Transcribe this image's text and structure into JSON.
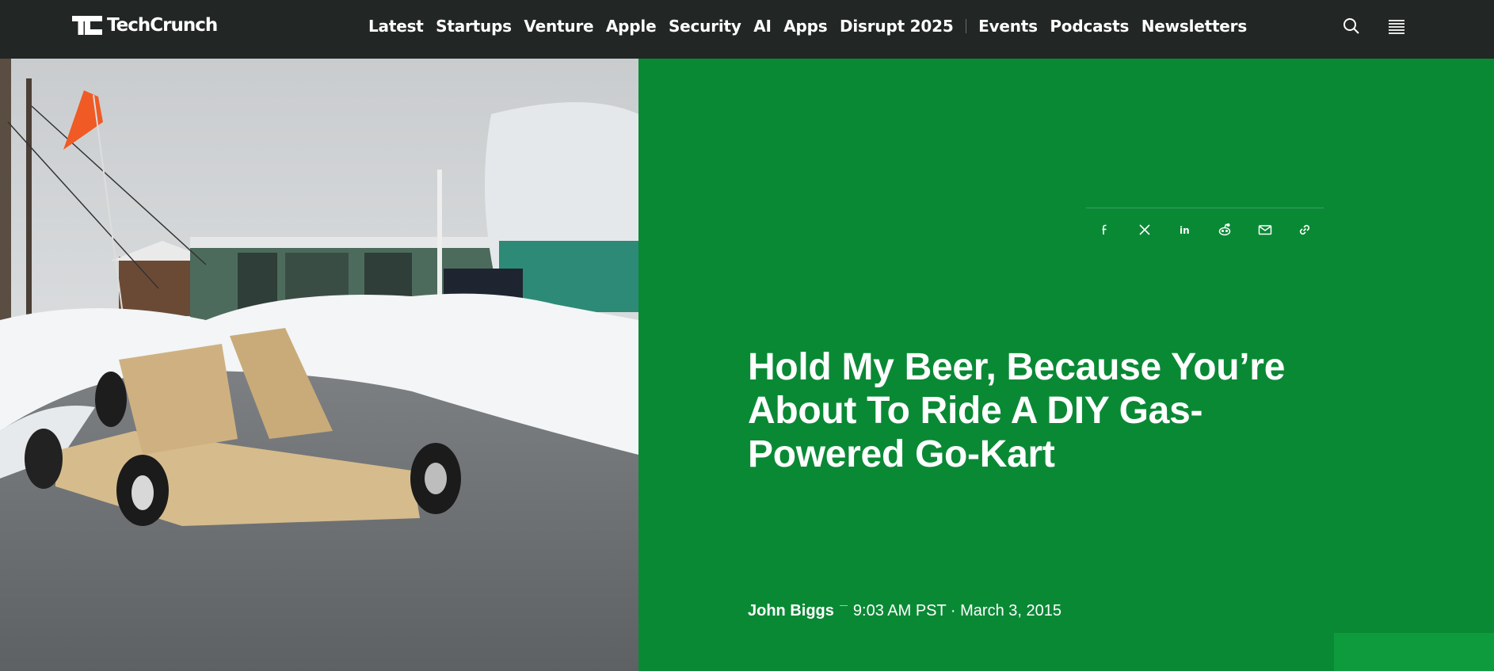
{
  "site": {
    "logo_text": "TechCrunch"
  },
  "nav": {
    "items": [
      "Latest",
      "Startups",
      "Venture",
      "Apple",
      "Security",
      "AI",
      "Apps",
      "Disrupt 2025"
    ],
    "secondary": [
      "Events",
      "Podcasts",
      "Newsletters"
    ]
  },
  "header_icons": [
    "search-icon",
    "menu-icon"
  ],
  "share_icons": [
    "facebook-icon",
    "x-icon",
    "linkedin-icon",
    "reddit-icon",
    "email-icon",
    "link-icon"
  ],
  "article": {
    "title": "Hold My Beer, Because You’re About To Ride A DIY Gas-Powered Go-Kart",
    "author": "John Biggs",
    "datetime": "9:03 AM PST · March 3, 2015"
  },
  "colors": {
    "header_bg": "#222624",
    "accent_green": "#0a8935",
    "corner_green": "#0d9b3e"
  }
}
